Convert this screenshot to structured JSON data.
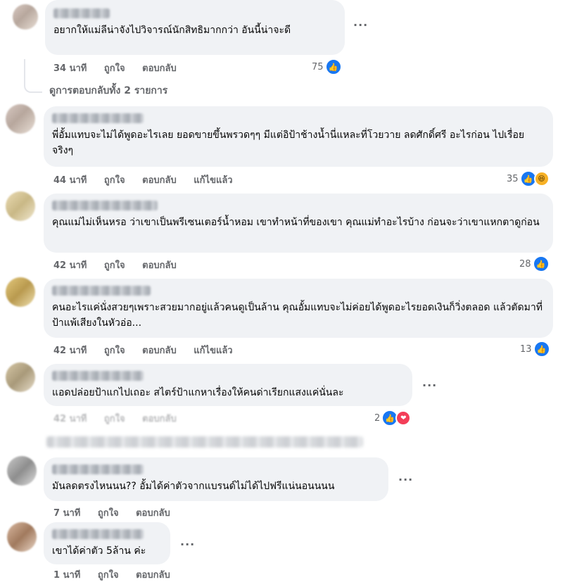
{
  "labels": {
    "like": "ถูกใจ",
    "reply": "ตอบกลับ",
    "edited": "แก้ไขแล้ว",
    "more": "···"
  },
  "view_replies": "ดูการตอบกลับทั้ง 2 รายการ",
  "comments": [
    {
      "text": "อยากให้แม่ลีน่าจังไปวิจารณ์นักสิทธิมากกว่า อันนี้น่าจะดี",
      "time": "34 นาที",
      "reactions": "75",
      "reaction_icons": [
        "like-icon"
      ]
    },
    {
      "text": "พี่อั้มแทบจะไม่ได้พูดอะไรเลย ยอดขายขึ้นพรวดๆๆ มีแต่อิป้าช้างน้ำนี่แหละที่โวยวาย ลดศักดิ์ศรี อะไรก่อน ไปเรื่อยจริงๆ",
      "time": "44 นาที",
      "edited": true,
      "reactions": "35",
      "reaction_icons": [
        "like-icon",
        "haha-icon"
      ]
    },
    {
      "text": "คุณแม่ไม่เห็นหรอ ว่าเขาเป็นพรีเซนเตอร์น้ำหอม เขาทำหน้าที่ของเขา คุณแม่ทำอะไรบ้าง ก่อนจะว่าเขาแหกตาดูก่อน",
      "time": "42 นาที",
      "reactions": "28",
      "reaction_icons": [
        "like-icon"
      ]
    },
    {
      "text": "คนอะไรแค่นั่งสวยๆเพราะสวยมากอยู่แล้วคนดูเป็นล้าน คุณอั้มแทบจะไม่ค่อยได้พูดอะไรยอดเงินก็วิ่งตลอด แล้วตัดมาที่ป้าแพ้เสียงในหัวอ่อ...",
      "time": "42 นาที",
      "edited": true,
      "reactions": "13",
      "reaction_icons": [
        "like-icon"
      ]
    },
    {
      "text": "แอดปล่อยป้าแกไปเถอะ สไตร์ป้าแกหาเรื่องให้คนด่าเรียกแสงแค่นั่นละ",
      "time": "42 นาที",
      "reactions": "2",
      "reaction_icons": [
        "like-icon",
        "love-icon"
      ]
    },
    {
      "text": "มันลดตรงไหนนน?? อั้มได้ค่าตัวจากแบรนด์ไม่ได้ไปฟรีแน่นอนนนน",
      "time": "7 นาที"
    },
    {
      "text": "เขาได้ค่าตัว 5ล้าน ค่ะ",
      "time": "1 นาที"
    }
  ],
  "colors": {
    "bubble": "#f0f2f5",
    "meta": "#65676b",
    "like": "#1877f2",
    "love": "#f33e58",
    "haha": "#f7b125"
  }
}
